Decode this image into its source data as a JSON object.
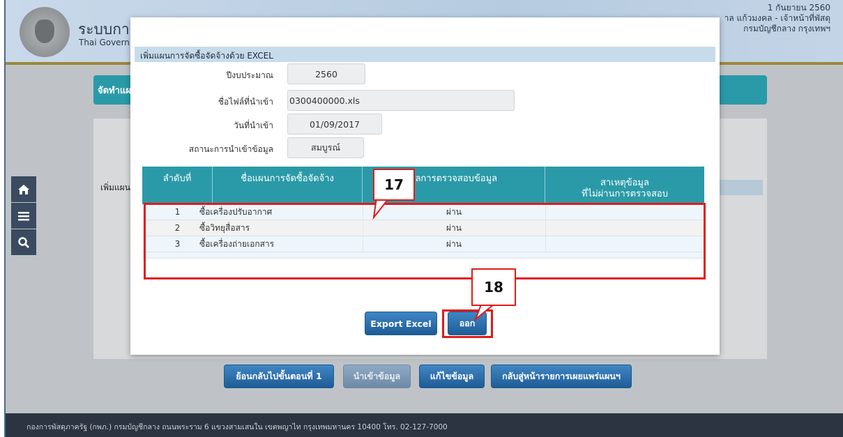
{
  "header": {
    "system_title": "ระบบการ",
    "system_subtitle": "Thai Governm",
    "date": "1 กันยายน 2560",
    "user": "าล แก้วมงคล - เจ้าหน้าที่พัสดุ",
    "department": "กรมบัญชีกลาง กรุงเทพฯ"
  },
  "background": {
    "section_title": "จัดทำแผ",
    "section_label": "เพิ่มแผน",
    "buttons": [
      {
        "label": "ย้อนกลับไปขั้นตอนที่ 1",
        "enabled": true
      },
      {
        "label": "นำเข้าข้อมูล",
        "enabled": false
      },
      {
        "label": "แก้ไขข้อมูล",
        "enabled": true
      },
      {
        "label": "กลับสู่หน้ารายการเผยแพร่แผนฯ",
        "enabled": true
      }
    ],
    "footer": "กองการพัสดุภาครัฐ (กพภ.) กรมบัญชีกลาง ถนนพระราม 6 แขวงสามเสนใน เขตพญาไท กรุงเทพมหานคร 10400 โทร. 02-127-7000"
  },
  "sidebar": {
    "icons": [
      "home-icon",
      "menu-icon",
      "search-icon"
    ]
  },
  "modal": {
    "title": "เพิ่มแผนการจัดซื้อจัดจ้างด้วย EXCEL",
    "fields": {
      "fiscal_year_label": "ปีงบประมาณ",
      "fiscal_year": "2560",
      "file_name_label": "ชื่อไฟล์ที่นำเข้า",
      "file_name": "0300400000.xls",
      "import_date_label": "วันที่นำเข้า",
      "import_date": "01/09/2017",
      "import_status_label": "สถานะการนำเข้าข้อมูล",
      "import_status": "สมบูรณ์"
    },
    "table": {
      "columns": [
        "ลำดับที่",
        "ชื่อแผนการจัดซื้อจัดจ้าง",
        "ผลการตรวจสอบข้อมูล",
        "สาเหตุข้อมูล",
        "ที่ไม่ผ่านการตรวจสอบ"
      ],
      "rows": [
        {
          "no": "1",
          "name": "ซื้อเครื่องปรับอากาศ",
          "result": "ผ่าน",
          "reason": ""
        },
        {
          "no": "2",
          "name": "ซื้อวิทยุสื่อสาร",
          "result": "ผ่าน",
          "reason": ""
        },
        {
          "no": "3",
          "name": "ซื้อเครื่องถ่ายเอกสาร",
          "result": "ผ่าน",
          "reason": ""
        }
      ]
    },
    "export_label": "Export Excel",
    "exit_label": "ออก"
  },
  "annotations": {
    "callout_table": "17",
    "callout_exit": "18",
    "highlight_color": "#e01b1b"
  }
}
